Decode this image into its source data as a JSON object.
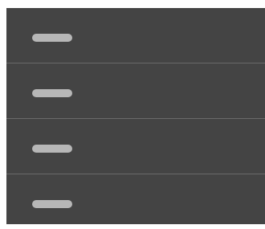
{
  "list": {
    "rows": [
      {
        "label": ""
      },
      {
        "label": ""
      },
      {
        "label": ""
      },
      {
        "label": ""
      }
    ]
  },
  "colors": {
    "panel_bg": "#444444",
    "divider": "#6a6a6a",
    "skeleton": "#b7b7b7",
    "page_bg": "#ffffff"
  }
}
